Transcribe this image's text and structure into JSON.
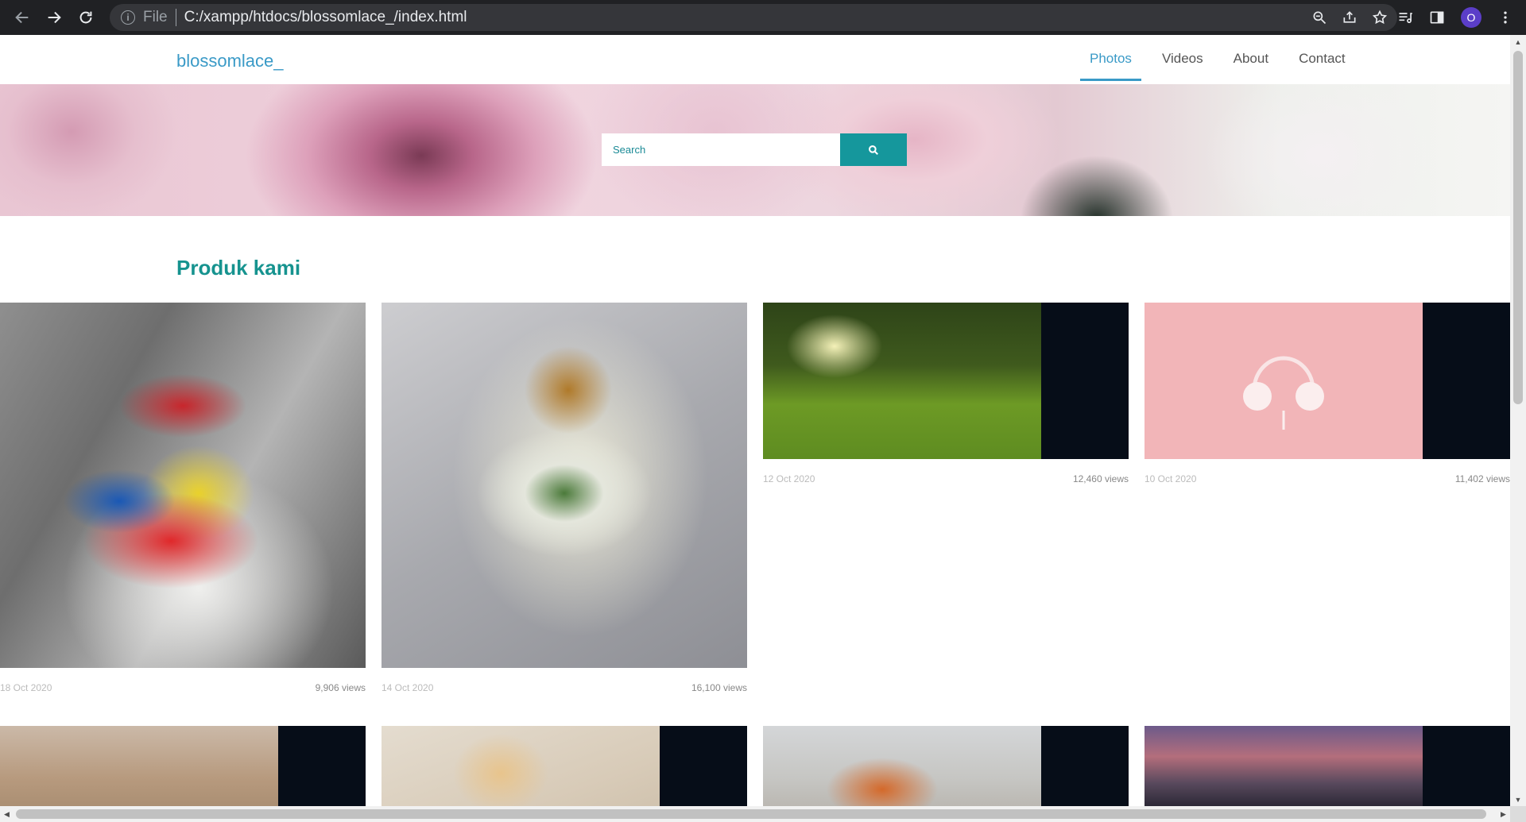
{
  "browser": {
    "scheme": "File",
    "url": "C:/xampp/htdocs/blossomlace_/index.html",
    "profile_initial": "O"
  },
  "site": {
    "brand": "blossomlace_",
    "nav": [
      {
        "label": "Photos",
        "active": true
      },
      {
        "label": "Videos",
        "active": false
      },
      {
        "label": "About",
        "active": false
      },
      {
        "label": "Contact",
        "active": false
      }
    ],
    "search": {
      "placeholder": "Search"
    },
    "section_title": "Produk kami",
    "products": [
      {
        "date": "18 Oct 2020",
        "views": "9,906 views",
        "image": "snack-bouquet-photo"
      },
      {
        "date": "14 Oct 2020",
        "views": "16,100 views",
        "image": "teddy-bear-bouquet-photo"
      },
      {
        "date": "12 Oct 2020",
        "views": "12,460 views",
        "image": "green-field-photo"
      },
      {
        "date": "10 Oct 2020",
        "views": "11,402 views",
        "image": "pink-headphones-photo"
      },
      {
        "image": "wooden-hangers-photo"
      },
      {
        "image": "perfume-bottles-photo"
      },
      {
        "image": "toy-van-photo"
      },
      {
        "image": "city-skyline-photo"
      }
    ]
  },
  "colors": {
    "brand": "#3a9ac7",
    "accent": "#15979c",
    "chrome": "#202124"
  }
}
